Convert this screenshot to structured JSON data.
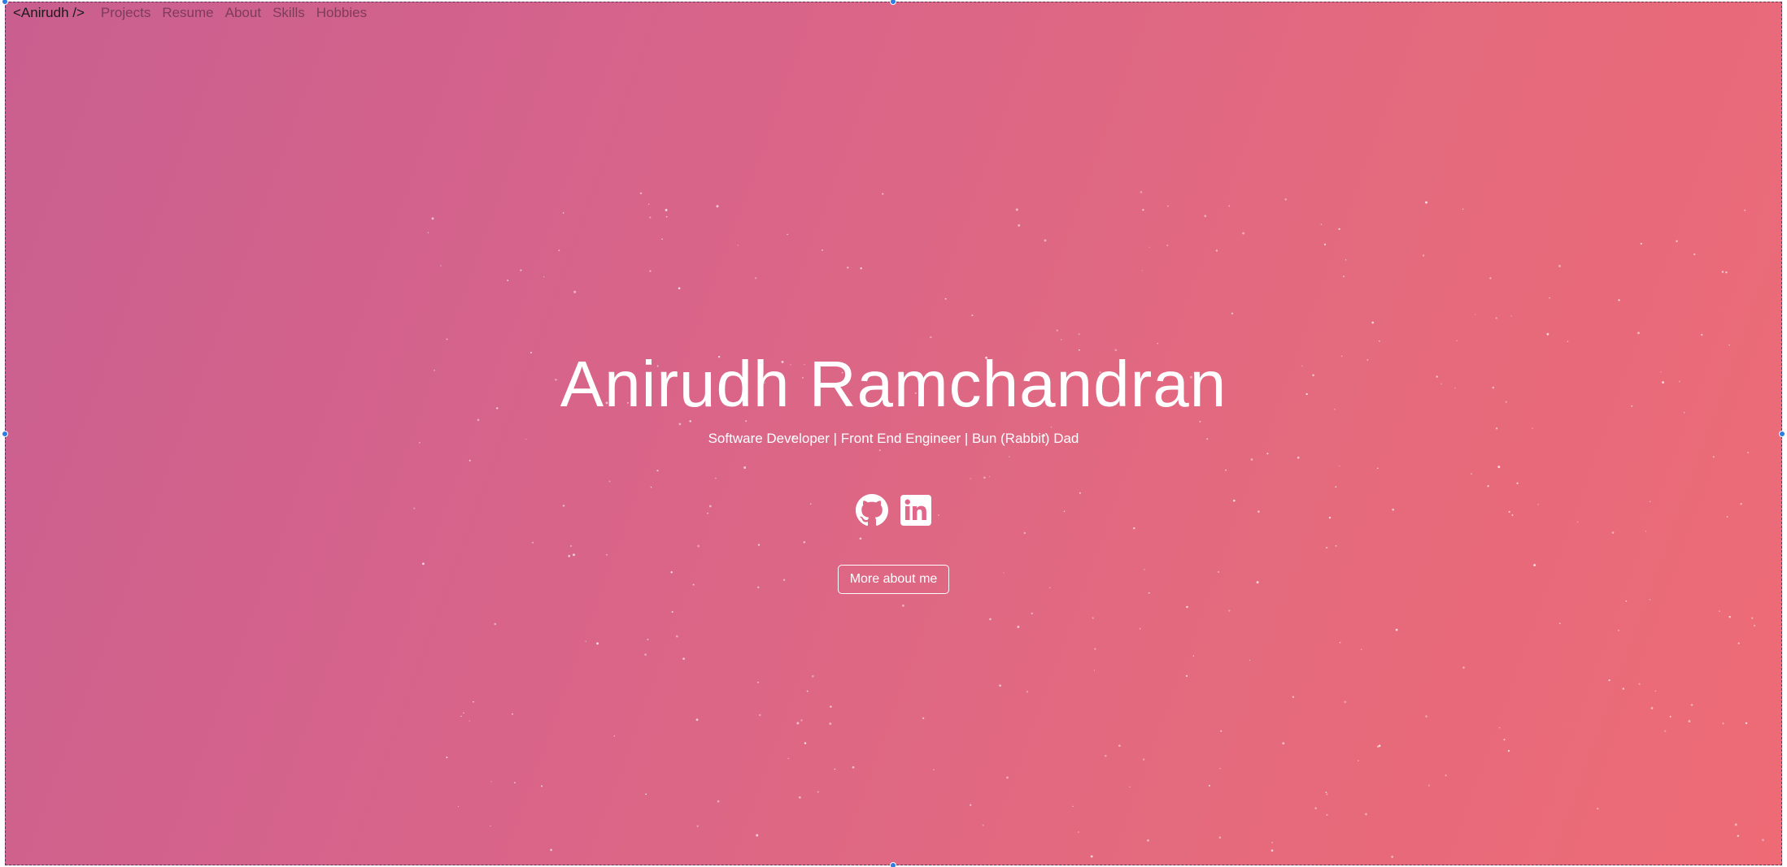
{
  "nav": {
    "brand": "<Anirudh />",
    "links": [
      "Projects",
      "Resume",
      "About",
      "Skills",
      "Hobbies"
    ]
  },
  "hero": {
    "title": "Anirudh Ramchandran",
    "subtitle": "Software Developer | Front End Engineer | Bun (Rabbit) Dad",
    "social_icons": [
      "github-icon",
      "linkedin-icon"
    ],
    "cta_label": "More about me"
  },
  "colors": {
    "gradient_start": "#c95f8f",
    "gradient_end": "#ee6b76",
    "text": "#ffffff",
    "selection_handle": "#2f7de1"
  }
}
